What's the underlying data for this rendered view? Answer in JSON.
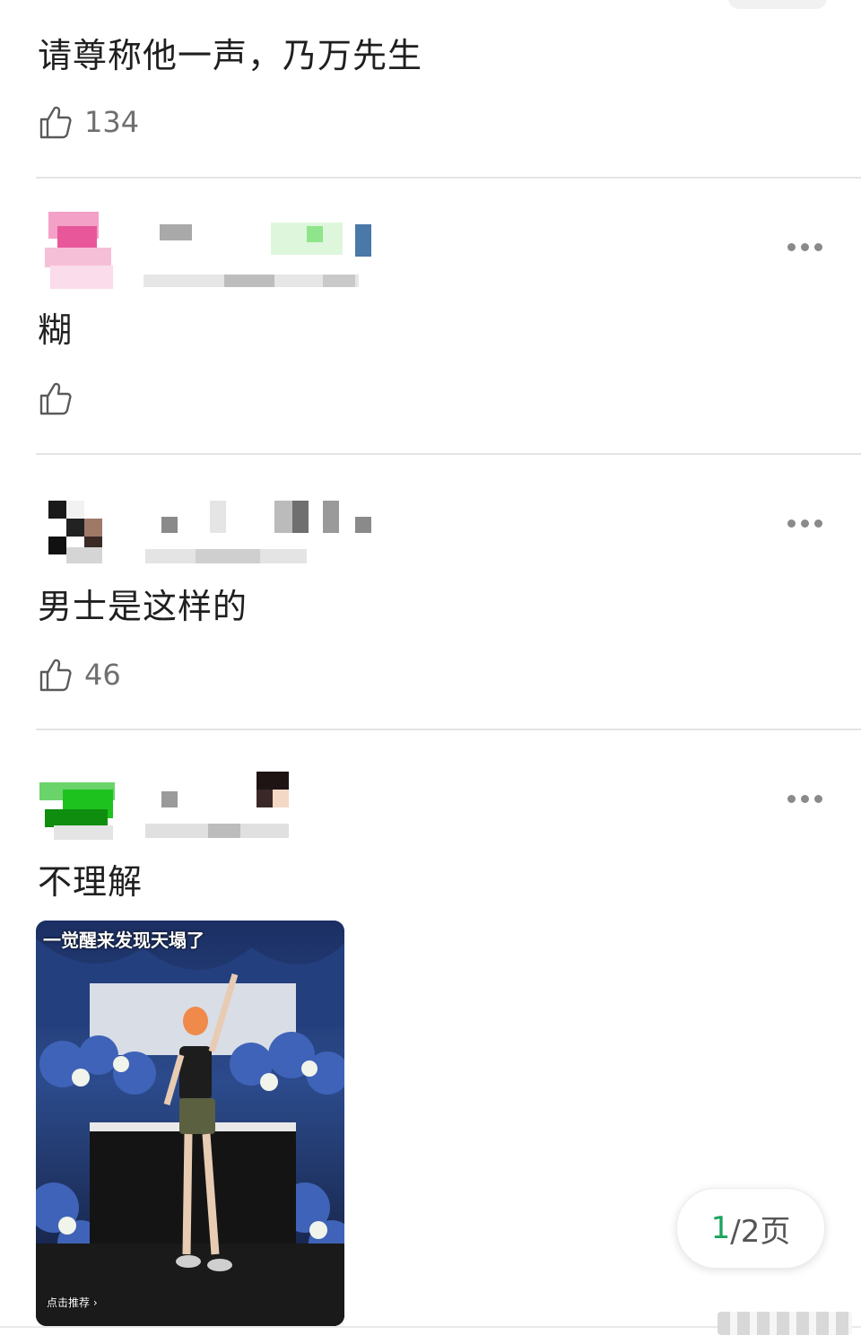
{
  "comments": [
    {
      "text": "请尊称他一声，乃万先生",
      "likes": "134"
    },
    {
      "text": "糊",
      "likes": ""
    },
    {
      "text": "男士是这样的",
      "likes": "46"
    },
    {
      "text": "不理解",
      "likes": ""
    }
  ],
  "media": {
    "caption": "一觉醒来发现天塌了",
    "bottom_label": "点击推荐 ›"
  },
  "pager": {
    "current": "1",
    "rest": "/2页"
  },
  "colors": {
    "accent_green": "#1aa55f",
    "text": "#1f1f1f",
    "muted": "#6f6f6f"
  }
}
